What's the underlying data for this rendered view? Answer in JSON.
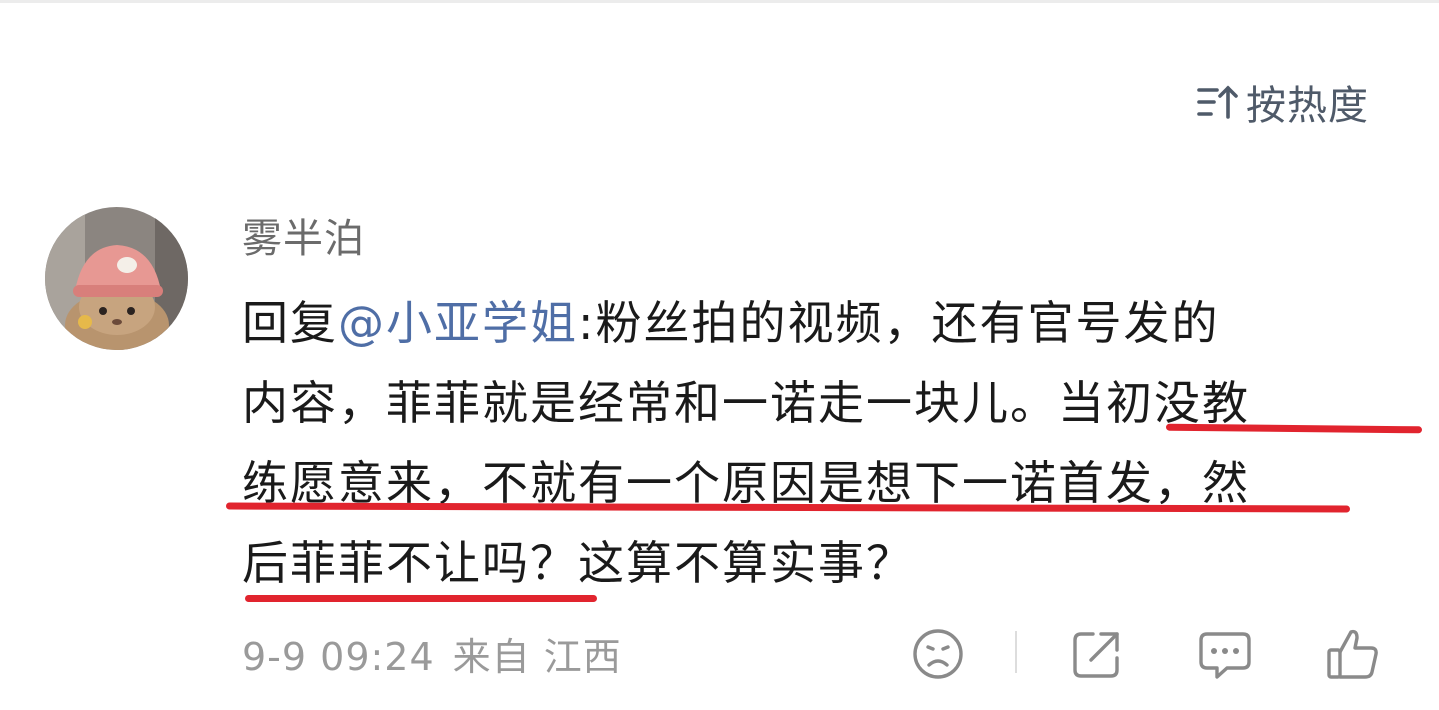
{
  "sort": {
    "label": "按热度",
    "icon": "sort-icon"
  },
  "comment": {
    "username": "雾半泊",
    "reply_prefix": "回复",
    "mention": "@小亚学姐",
    "line1_rest": ":粉丝拍的视频，还有官号发的",
    "line2": "内容，菲菲就是经常和一诺走一块儿。当初没教",
    "line3": "练愿意来，不就有一个原因是想下一诺首发，然",
    "line4": "后菲菲不让吗？这算不算实事？",
    "timestamp": "9-9 09:24",
    "source": "来自 江西"
  },
  "actions": [
    {
      "name": "sad-face-icon"
    },
    {
      "name": "share-icon"
    },
    {
      "name": "comment-icon"
    },
    {
      "name": "like-icon"
    }
  ],
  "colors": {
    "accent": "#e1242e",
    "link": "#4f6ea6",
    "muted": "#9a9a9a"
  }
}
